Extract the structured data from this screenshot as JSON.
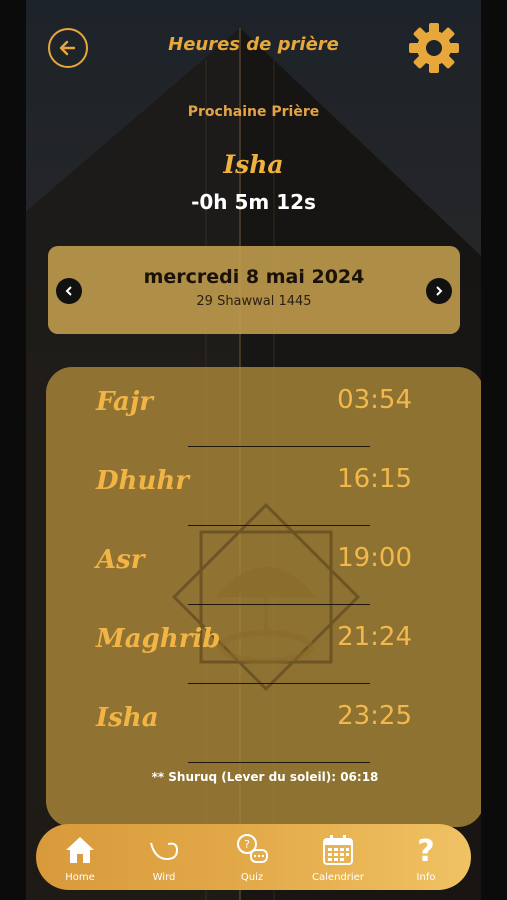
{
  "header": {
    "title": "Heures de prière"
  },
  "next_prayer": {
    "label": "Prochaine Prière",
    "name": "Isha",
    "countdown": "-0h 5m 12s"
  },
  "date": {
    "gregorian": "mercredi 8 mai 2024",
    "hijri": "29 Shawwal 1445"
  },
  "prayers": [
    {
      "name": "Fajr",
      "time": "03:54"
    },
    {
      "name": "Dhuhr",
      "time": "16:15"
    },
    {
      "name": "Asr",
      "time": "19:00"
    },
    {
      "name": "Maghrib",
      "time": "21:24"
    },
    {
      "name": "Isha",
      "time": "23:25"
    }
  ],
  "shuruq": "** Shuruq (Lever du soleil): 06:18",
  "nav": [
    {
      "label": "Home",
      "icon": "home-icon"
    },
    {
      "label": "Wird",
      "icon": "wird-icon"
    },
    {
      "label": "Quiz",
      "icon": "quiz-icon"
    },
    {
      "label": "Calendrier",
      "icon": "calendar-icon"
    },
    {
      "label": "Info",
      "icon": "info-icon"
    }
  ],
  "colors": {
    "accent": "#e7a73b",
    "card": "#c49e4e",
    "nav": "#e3aa4a"
  }
}
